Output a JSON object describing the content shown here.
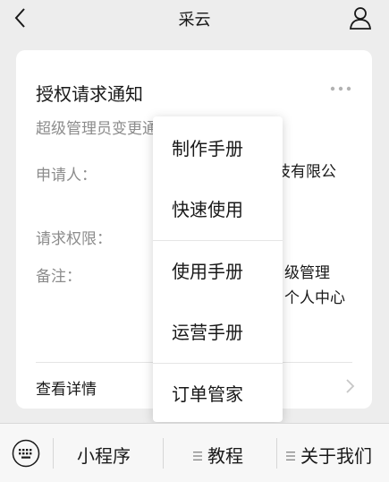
{
  "nav": {
    "title": "采云"
  },
  "card": {
    "title": "授权请求通知",
    "subtitle": "超级管理员变更通",
    "rows": [
      {
        "label": "申请人：",
        "value_fragment": "技有限公"
      },
      {
        "label": "请求权限："
      },
      {
        "label": "备注：",
        "value_line1": "级管理",
        "value_line2": "个人中心"
      }
    ],
    "detail_label": "查看详情"
  },
  "menu": {
    "items": [
      "制作手册",
      "快速使用",
      "使用手册",
      "运营手册",
      "订单管家"
    ]
  },
  "bottom_tabs": [
    "小程序",
    "教程",
    "关于我们"
  ]
}
